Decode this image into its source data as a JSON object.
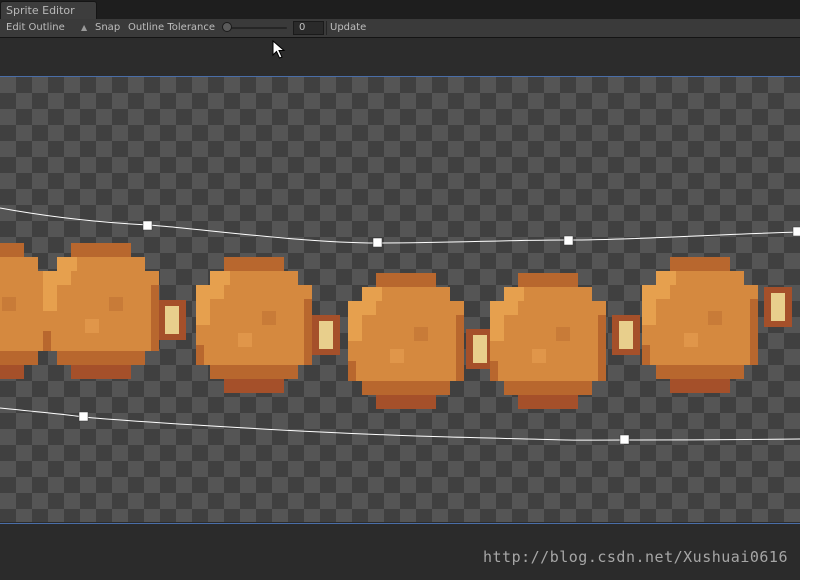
{
  "window": {
    "tab_title": "Sprite Editor"
  },
  "toolbar": {
    "mode_label": "Edit Outline",
    "snap_label": "Snap",
    "tolerance_label": "Outline Tolerance",
    "tolerance_value": "0",
    "tolerance_level": 0,
    "update_label": "Update"
  },
  "watermark": "http://blog.csdn.net/Xushuai0616",
  "colors": {
    "panel": "#3a3a3a",
    "canvas_border": "#4a6ea8",
    "outline": "#ffffff",
    "coin": "#d5893f",
    "coin_dark": "#a5502a",
    "coin_light": "#e6a04e",
    "link": "#e8cf8c"
  },
  "icons": {
    "cursor": "arrow-cursor-icon",
    "mode": "up-down-arrows-icon"
  }
}
